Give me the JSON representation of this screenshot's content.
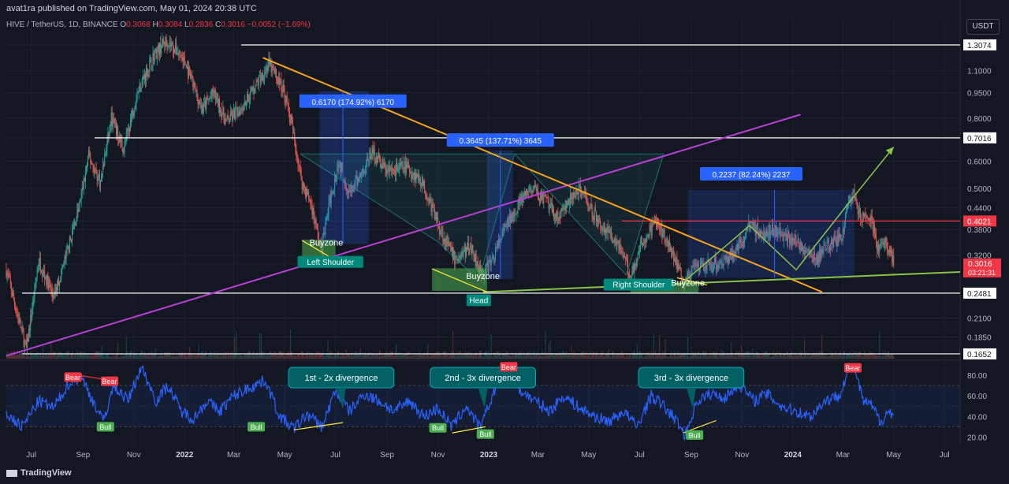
{
  "header": {
    "published": "avat1ra published on TradingView.com, May 01, 2024 20:38 UTC",
    "symbol": "HIVE / TetherUS, 1D, BINANCE",
    "ohlc": {
      "o": "0.3068",
      "h": "0.3084",
      "l": "0.2836",
      "c": "0.3016",
      "chg": "−0.0052 (−1.69%)"
    }
  },
  "currency": "USDT",
  "brand": "TradingView",
  "colors": {
    "bg": "#131722",
    "up": "#26a69a",
    "down": "#ef5350",
    "rsi": "#2962ff",
    "orange": "#f7a21b",
    "purple": "#b93fd6",
    "green": "#8bc34a",
    "red": "#f23645"
  },
  "chart_data": [
    {
      "type": "candlestick",
      "yscale": "log",
      "price_ticks": [
        "1.3074",
        "1.1000",
        "0.9500",
        "0.8000",
        "0.7016",
        "0.6000",
        "0.5000",
        "0.4400",
        "0.4021",
        "0.3800",
        "0.3200",
        "0.3016",
        "0.2481",
        "0.2100",
        "0.1850",
        "0.1652"
      ],
      "tick_values": [
        1.3074,
        1.1,
        0.95,
        0.8,
        0.7016,
        0.6,
        0.5,
        0.44,
        0.4021,
        0.38,
        0.32,
        0.3016,
        0.2481,
        0.21,
        0.185,
        0.1652
      ],
      "last_price": {
        "value": 0.3016,
        "label": "0.3016",
        "countdown": "03:21:31"
      },
      "x_labels": [
        "Jul",
        "Sep",
        "Nov",
        "2022",
        "Mar",
        "May",
        "Jul",
        "Sep",
        "Nov",
        "2023",
        "Mar",
        "May",
        "Jul",
        "Sep",
        "Nov",
        "2024",
        "Mar",
        "May",
        "Jul"
      ],
      "x_dates": [
        "2021-07-01",
        "2021-09-01",
        "2021-11-01",
        "2022-01-01",
        "2022-03-01",
        "2022-05-01",
        "2022-07-01",
        "2022-09-01",
        "2022-11-01",
        "2023-01-01",
        "2023-03-01",
        "2023-05-01",
        "2023-07-01",
        "2023-09-01",
        "2023-11-01",
        "2024-01-01",
        "2024-03-01",
        "2024-05-01",
        "2024-07-01"
      ],
      "price_path": [
        [
          "2021-06-01",
          0.29
        ],
        [
          "2021-06-25",
          0.17
        ],
        [
          "2021-07-10",
          0.31
        ],
        [
          "2021-07-28",
          0.24
        ],
        [
          "2021-08-15",
          0.34
        ],
        [
          "2021-08-28",
          0.45
        ],
        [
          "2021-09-08",
          0.62
        ],
        [
          "2021-09-22",
          0.52
        ],
        [
          "2021-10-05",
          0.8
        ],
        [
          "2021-10-20",
          0.65
        ],
        [
          "2021-11-05",
          0.95
        ],
        [
          "2021-11-25",
          1.22
        ],
        [
          "2021-12-10",
          1.35
        ],
        [
          "2021-12-28",
          1.22
        ],
        [
          "2022-01-08",
          1.05
        ],
        [
          "2022-01-22",
          0.85
        ],
        [
          "2022-02-05",
          0.95
        ],
        [
          "2022-02-20",
          0.78
        ],
        [
          "2022-03-08",
          0.85
        ],
        [
          "2022-03-28",
          1.0
        ],
        [
          "2022-04-12",
          1.15
        ],
        [
          "2022-04-22",
          1.05
        ],
        [
          "2022-05-01",
          0.95
        ],
        [
          "2022-05-10",
          0.75
        ],
        [
          "2022-05-22",
          0.52
        ],
        [
          "2022-06-02",
          0.45
        ],
        [
          "2022-06-14",
          0.33
        ],
        [
          "2022-06-24",
          0.46
        ],
        [
          "2022-07-05",
          0.6
        ],
        [
          "2022-07-18",
          0.48
        ],
        [
          "2022-08-02",
          0.56
        ],
        [
          "2022-08-14",
          0.64
        ],
        [
          "2022-09-01",
          0.56
        ],
        [
          "2022-09-22",
          0.58
        ],
        [
          "2022-10-12",
          0.53
        ],
        [
          "2022-10-28",
          0.42
        ],
        [
          "2022-11-08",
          0.36
        ],
        [
          "2022-11-22",
          0.31
        ],
        [
          "2022-12-10",
          0.34
        ],
        [
          "2022-12-25",
          0.28
        ],
        [
          "2023-01-05",
          0.31
        ],
        [
          "2023-01-20",
          0.38
        ],
        [
          "2023-02-05",
          0.45
        ],
        [
          "2023-02-22",
          0.5
        ],
        [
          "2023-03-10",
          0.46
        ],
        [
          "2023-03-25",
          0.41
        ],
        [
          "2023-04-08",
          0.46
        ],
        [
          "2023-04-22",
          0.5
        ],
        [
          "2023-05-05",
          0.43
        ],
        [
          "2023-05-20",
          0.38
        ],
        [
          "2023-06-05",
          0.35
        ],
        [
          "2023-06-20",
          0.28
        ],
        [
          "2023-07-05",
          0.35
        ],
        [
          "2023-07-20",
          0.4
        ],
        [
          "2023-08-05",
          0.35
        ],
        [
          "2023-08-22",
          0.27
        ],
        [
          "2023-09-05",
          0.29
        ],
        [
          "2023-09-25",
          0.3
        ],
        [
          "2023-10-12",
          0.31
        ],
        [
          "2023-10-28",
          0.34
        ],
        [
          "2023-11-10",
          0.39
        ],
        [
          "2023-11-28",
          0.37
        ],
        [
          "2023-12-10",
          0.38
        ],
        [
          "2023-12-28",
          0.36
        ],
        [
          "2024-01-12",
          0.34
        ],
        [
          "2024-01-28",
          0.31
        ],
        [
          "2024-02-12",
          0.34
        ],
        [
          "2024-02-28",
          0.36
        ],
        [
          "2024-03-08",
          0.46
        ],
        [
          "2024-03-14",
          0.48
        ],
        [
          "2024-03-22",
          0.41
        ],
        [
          "2024-04-05",
          0.4
        ],
        [
          "2024-04-12",
          0.33
        ],
        [
          "2024-04-22",
          0.35
        ],
        [
          "2024-05-01",
          0.3016
        ]
      ],
      "horizontal_levels": [
        {
          "value": 1.3074,
          "color": "#ffffff"
        },
        {
          "value": 0.7016,
          "color": "#ffffff"
        },
        {
          "value": 0.4021,
          "color": "#f23645"
        },
        {
          "value": 0.2481,
          "color": "#ffffff"
        },
        {
          "value": 0.1652,
          "color": "#ffffff"
        }
      ],
      "measure_labels": [
        {
          "text": "0.6170 (174.92%) 6170",
          "date": "2022-07-22",
          "value": 0.895
        },
        {
          "text": "0.3645 (137.71%) 3645",
          "date": "2023-01-15",
          "value": 0.69
        },
        {
          "text": "0.2237 (82.24%) 2237",
          "date": "2023-11-12",
          "value": 0.55
        }
      ],
      "pattern_labels": [
        {
          "text": "Buyzone",
          "date": "2022-06-20",
          "value": 0.347,
          "style": "plain"
        },
        {
          "text": "Left Shoulder",
          "date": "2022-06-25",
          "value": 0.305,
          "style": "teal"
        },
        {
          "text": "Buyzone",
          "date": "2022-12-25",
          "value": 0.277,
          "style": "plain"
        },
        {
          "text": "Head",
          "date": "2022-12-20",
          "value": 0.236,
          "style": "teal"
        },
        {
          "text": "Right Shoulder",
          "date": "2023-06-30",
          "value": 0.262,
          "style": "teal"
        },
        {
          "text": "Buyzone",
          "date": "2023-08-28",
          "value": 0.265,
          "style": "plain"
        }
      ]
    },
    {
      "type": "line",
      "series_kind": "RSI",
      "y_ticks": [
        "80.00",
        "60.00",
        "40.00",
        "20.00"
      ],
      "y_values": [
        80,
        60,
        40,
        20
      ],
      "ylim": [
        12,
        92
      ],
      "band": [
        30,
        70
      ],
      "midline": 50,
      "rsi_path": [
        [
          "2021-06-01",
          42
        ],
        [
          "2021-06-20",
          30
        ],
        [
          "2021-07-10",
          55
        ],
        [
          "2021-07-28",
          48
        ],
        [
          "2021-08-15",
          72
        ],
        [
          "2021-08-30",
          78
        ],
        [
          "2021-09-10",
          60
        ],
        [
          "2021-09-25",
          35
        ],
        [
          "2021-10-08",
          70
        ],
        [
          "2021-10-25",
          55
        ],
        [
          "2021-11-10",
          88
        ],
        [
          "2021-11-28",
          55
        ],
        [
          "2021-12-12",
          70
        ],
        [
          "2021-12-28",
          45
        ],
        [
          "2022-01-12",
          38
        ],
        [
          "2022-01-28",
          55
        ],
        [
          "2022-02-12",
          45
        ],
        [
          "2022-03-01",
          60
        ],
        [
          "2022-03-20",
          68
        ],
        [
          "2022-04-08",
          75
        ],
        [
          "2022-04-25",
          40
        ],
        [
          "2022-05-12",
          28
        ],
        [
          "2022-05-28",
          42
        ],
        [
          "2022-06-15",
          30
        ],
        [
          "2022-07-01",
          65
        ],
        [
          "2022-07-18",
          45
        ],
        [
          "2022-08-05",
          62
        ],
        [
          "2022-08-22",
          55
        ],
        [
          "2022-09-10",
          45
        ],
        [
          "2022-09-28",
          55
        ],
        [
          "2022-10-15",
          40
        ],
        [
          "2022-11-01",
          48
        ],
        [
          "2022-11-18",
          30
        ],
        [
          "2022-12-05",
          50
        ],
        [
          "2022-12-22",
          28
        ],
        [
          "2023-01-10",
          70
        ],
        [
          "2023-01-22",
          86
        ],
        [
          "2023-02-08",
          65
        ],
        [
          "2023-02-25",
          55
        ],
        [
          "2023-03-15",
          45
        ],
        [
          "2023-04-01",
          60
        ],
        [
          "2023-04-20",
          48
        ],
        [
          "2023-05-08",
          40
        ],
        [
          "2023-05-25",
          35
        ],
        [
          "2023-06-12",
          45
        ],
        [
          "2023-06-28",
          30
        ],
        [
          "2023-07-15",
          60
        ],
        [
          "2023-07-30",
          50
        ],
        [
          "2023-08-15",
          35
        ],
        [
          "2023-08-25",
          22
        ],
        [
          "2023-09-08",
          55
        ],
        [
          "2023-09-25",
          62
        ],
        [
          "2023-10-12",
          58
        ],
        [
          "2023-10-28",
          72
        ],
        [
          "2023-11-15",
          55
        ],
        [
          "2023-12-01",
          62
        ],
        [
          "2023-12-18",
          50
        ],
        [
          "2024-01-05",
          45
        ],
        [
          "2024-01-22",
          40
        ],
        [
          "2024-02-08",
          55
        ],
        [
          "2024-02-25",
          60
        ],
        [
          "2024-03-08",
          85
        ],
        [
          "2024-03-15",
          88
        ],
        [
          "2024-03-25",
          55
        ],
        [
          "2024-04-05",
          50
        ],
        [
          "2024-04-15",
          35
        ],
        [
          "2024-04-25",
          45
        ],
        [
          "2024-05-01",
          40
        ]
      ],
      "callouts": [
        {
          "text": "1st - 2x divergence",
          "date": "2022-07-08"
        },
        {
          "text": "2nd - 3x divergence",
          "date": "2022-12-25"
        },
        {
          "text": "3rd - 3x divergence",
          "date": "2023-09-01"
        }
      ],
      "signal_labels": [
        {
          "text": "Bear",
          "date": "2021-08-20",
          "value": 78,
          "color": "#f23645"
        },
        {
          "text": "Bear",
          "date": "2021-10-03",
          "value": 74,
          "color": "#f23645"
        },
        {
          "text": "Bull",
          "date": "2021-09-28",
          "value": 30,
          "color": "#4caf50"
        },
        {
          "text": "Bull",
          "date": "2022-03-28",
          "value": 30,
          "color": "#4caf50"
        },
        {
          "text": "Bull",
          "date": "2022-11-01",
          "value": 29,
          "color": "#4caf50"
        },
        {
          "text": "Bull",
          "date": "2022-12-28",
          "value": 23,
          "color": "#4caf50"
        },
        {
          "text": "Bear",
          "date": "2023-01-25",
          "value": 88,
          "color": "#f23645"
        },
        {
          "text": "Bull",
          "date": "2023-09-05",
          "value": 22,
          "color": "#4caf50"
        },
        {
          "text": "Bear",
          "date": "2024-03-13",
          "value": 87,
          "color": "#f23645"
        }
      ]
    }
  ]
}
